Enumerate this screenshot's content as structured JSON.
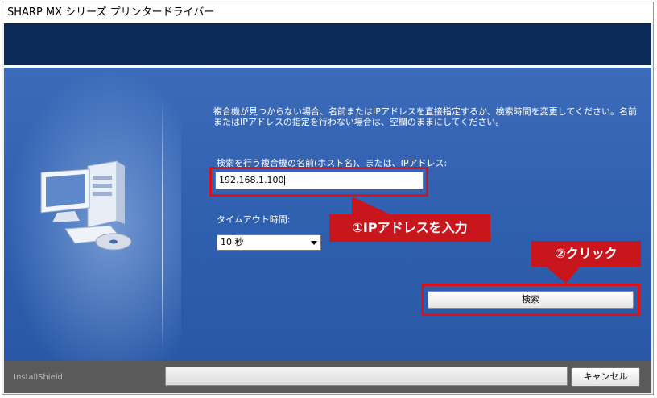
{
  "window": {
    "title": "SHARP MX シリーズ プリンタードライバー"
  },
  "main": {
    "instruction": "複合機が見つからない場合、名前またはIPアドレスを直接指定するか、検索時間を変更してください。名前またはIPアドレスの指定を行わない場合は、空欄のままにしてください。",
    "host_label": "検索を行う複合機の名前(ホスト名)、または、IPアドレス:",
    "host_value": "192.168.1.100",
    "timeout_label": "タイムアウト時間:",
    "timeout_selected": "10 秒",
    "search_button": "検索"
  },
  "annotations": {
    "callout_ip": "①IPアドレスを入力",
    "callout_click": "②クリック",
    "highlight_color": "#d8141a",
    "callout_color": "#c8161c"
  },
  "footer": {
    "brand": "InstallShield",
    "cancel_button": "キャンセル"
  },
  "icons": {
    "illustration": "computer-with-cd-icon",
    "dropdown": "chevron-down-icon"
  }
}
